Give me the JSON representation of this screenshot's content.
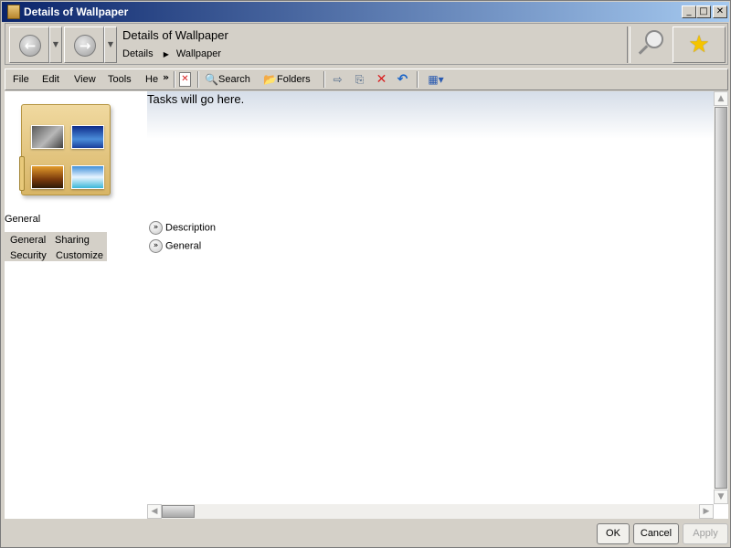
{
  "window": {
    "title": "Details of Wallpaper",
    "min_glyph": "_",
    "max_glyph": "□",
    "close_glyph": "✕"
  },
  "nav": {
    "back_glyph": "←",
    "forward_glyph": "→",
    "dropdown_glyph": "▼",
    "address_title": "Details of Wallpaper",
    "breadcrumb": [
      "Details",
      "Wallpaper"
    ],
    "breadcrumb_sep": "▶",
    "favorite_glyph": "★"
  },
  "toolbar": {
    "menus": [
      "File",
      "Edit",
      "View",
      "Tools",
      "He"
    ],
    "overflow": "»",
    "close_doc_glyph": "✕",
    "search_label": "Search",
    "folders_label": "Folders",
    "search_glyph": "🔍",
    "folders_glyph": "📂",
    "move_glyph": "⇨",
    "copy_glyph": "⎘",
    "delete_glyph": "✕",
    "undo_glyph": "↶",
    "views_glyph": "▦▾"
  },
  "left_pane": {
    "caption": "General",
    "tabs": [
      "General",
      "Sharing",
      "Security",
      "Customize"
    ]
  },
  "main": {
    "tasks_text": "Tasks will go here.",
    "expander_glyph": "»",
    "sections": [
      "Description",
      "General"
    ]
  },
  "scroll": {
    "up": "▲",
    "down": "▼",
    "left": "◀",
    "right": "▶"
  },
  "buttons": {
    "ok": "OK",
    "cancel": "Cancel",
    "apply": "Apply"
  },
  "colors": {
    "titlebar_start": "#0a246a",
    "titlebar_end": "#a6caf0",
    "delete": "#d82020",
    "undo": "#1a64c8",
    "favorite": "#f5c400"
  }
}
